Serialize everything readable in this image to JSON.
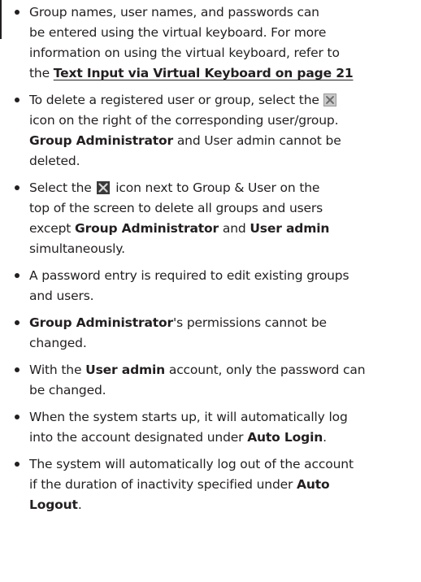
{
  "bullets": [
    {
      "lines": [
        "Group names, user names, and passwords can",
        "be entered using the virtual keyboard. For more",
        "information on using the virtual keyboard, refer to",
        "the "
      ],
      "link": "Text Input via Virtual Keyboard on page 21"
    },
    {
      "l1": "To delete a registered user or group, select the",
      "l2": "icon on the right of the corresponding user/group.",
      "l3_bold": "Group Administrator",
      "l3_rest": " and User admin cannot be",
      "l4": "deleted."
    },
    {
      "l1a": "Select the",
      "l1b": " icon next to Group & User on the",
      "l2": "top of the screen to delete all groups and users",
      "l3a": "except ",
      "l3b": "Group Administrator",
      "l3c": " and ",
      "l3d": "User admin",
      "l4": "simultaneously."
    },
    {
      "l1": "A password entry is required to edit existing groups",
      "l2": "and users."
    },
    {
      "l1_bold": "Group Administrator",
      "l1_rest": "'s permissions cannot be",
      "l2": "changed."
    },
    {
      "l1a": "With the ",
      "l1b": "User admin",
      "l1c": " account, only the password can",
      "l2": "be changed."
    },
    {
      "l1": "When the system starts up, it will automatically log",
      "l2a": "into the account designated under ",
      "l2b": "Auto Login",
      "l2c": "."
    },
    {
      "l1": "The system will automatically log out of the account",
      "l2a": "if the duration of inactivity specified under ",
      "l2b": "Auto",
      "l3a": "Logout",
      "l3b": "."
    }
  ],
  "icons": {
    "delete_single": "delete-x-icon",
    "delete_all": "delete-all-x-icon"
  }
}
